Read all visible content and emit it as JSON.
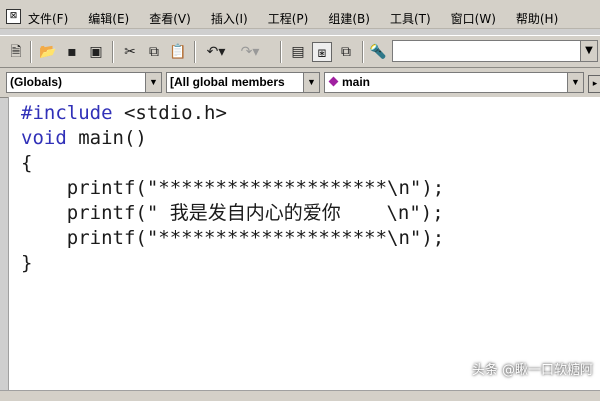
{
  "menu": {
    "items": [
      "文件(F)",
      "编辑(E)",
      "查看(V)",
      "插入(I)",
      "工程(P)",
      "组建(B)",
      "工具(T)",
      "窗口(W)",
      "帮助(H)"
    ]
  },
  "toolbar": {
    "icons": [
      "new-file-icon",
      "open-folder-icon",
      "save-icon",
      "save-all-icon",
      "cut-icon",
      "copy-icon",
      "paste-icon",
      "undo-icon",
      "redo-icon",
      "workspace-icon",
      "output-icon",
      "window-list-icon",
      "find-in-files-icon"
    ],
    "find_value": ""
  },
  "wizardbar": {
    "scope": "(Globals)",
    "filter": "[All global members",
    "member": "main"
  },
  "editor": {
    "lines": [
      {
        "kw": "#include",
        "text": " <stdio.h>"
      },
      {
        "kw": "void",
        "text": " main()"
      },
      {
        "kw": "",
        "text": "{"
      },
      {
        "kw": "",
        "text": "    printf(\"********************\\n\");"
      },
      {
        "kw": "",
        "text": "    printf(\" 我是发自内心的爱你    \\n\");"
      },
      {
        "kw": "",
        "text": "    printf(\"********************\\n\");"
      },
      {
        "kw": "",
        "text": "}"
      }
    ]
  },
  "watermark": "头条 @瞅一口软糖阿",
  "colors": {
    "keyword": "#3030b8",
    "chrome": "#d4d0c8"
  }
}
